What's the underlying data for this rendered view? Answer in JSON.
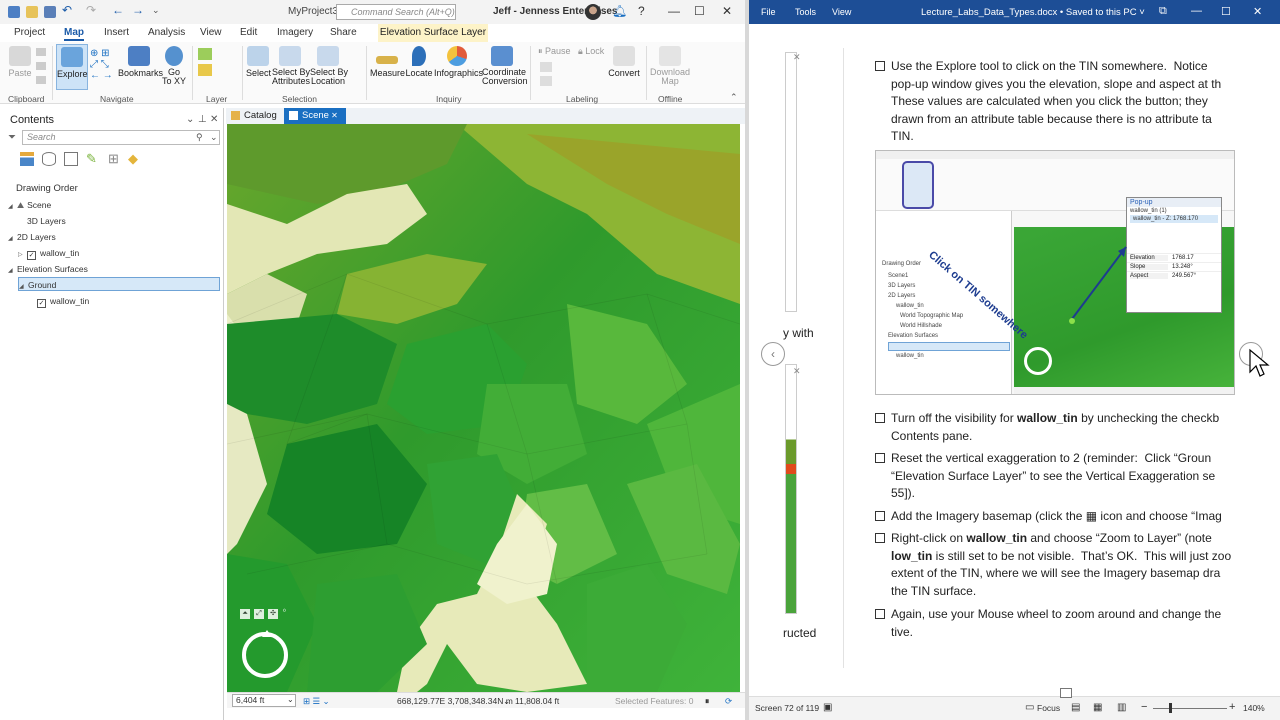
{
  "arcgis": {
    "title": "MyProject3",
    "command_search_placeholder": "Command Search (Alt+Q)",
    "user": "Jeff - Jenness Enterprises",
    "ribbon_tabs": [
      "Project",
      "Map",
      "Insert",
      "Analysis",
      "View",
      "Edit",
      "Imagery",
      "Share"
    ],
    "active_tab": "Map",
    "contextual_tab": "Elevation Surface Layer",
    "ribbon": {
      "paste": "Paste",
      "explore": "Explore",
      "bookmarks": "Bookmarks",
      "goto_xy": "Go\nTo XY",
      "select": "Select",
      "select_by_attributes": "Select By\nAttributes",
      "select_by_location": "Select By\nLocation",
      "measure": "Measure",
      "locate": "Locate",
      "infographics": "Infographics",
      "coordinate_conversion": "Coordinate\nConversion",
      "pause": "Pause",
      "lock": "Lock",
      "convert": "Convert",
      "download_map": "Download\nMap",
      "groups": [
        "Clipboard",
        "Navigate",
        "Layer",
        "Selection",
        "Inquiry",
        "Labeling",
        "Offline"
      ]
    },
    "contents": {
      "title": "Contents",
      "search_placeholder": "Search",
      "drawing_order": "Drawing Order",
      "tree": [
        {
          "label": "Scene",
          "indent": 0,
          "expander": "◢",
          "checkbox": false
        },
        {
          "label": "3D Layers",
          "indent": 1,
          "expander": "",
          "checkbox": false
        },
        {
          "label": "2D Layers",
          "indent": 0,
          "expander": "◢",
          "checkbox": false
        },
        {
          "label": "wallow_tin",
          "indent": 1,
          "expander": "▷",
          "checkbox": true
        },
        {
          "label": "Elevation Surfaces",
          "indent": 0,
          "expander": "◢",
          "checkbox": false
        },
        {
          "label": "Ground",
          "indent": 1,
          "expander": "◢",
          "checkbox": false,
          "selected": true
        },
        {
          "label": "wallow_tin",
          "indent": 2,
          "expander": "",
          "checkbox": true
        }
      ]
    },
    "view_tabs": [
      {
        "label": "Catalog",
        "active": false
      },
      {
        "label": "Scene",
        "active": true
      }
    ],
    "status": {
      "scale": "6,404 ft",
      "coordinates": "668,129.77E 3,708,348.34N m",
      "elevation": "11,808.04 ft",
      "selected_features": "Selected Features: 0"
    }
  },
  "word": {
    "menu": [
      "File",
      "Tools",
      "View"
    ],
    "doc_title": "Lecture_Labs_Data_Types.docx • Saved to this PC ˅",
    "side_text_1": "y with",
    "side_text_2": "ructed",
    "items": [
      {
        "html": "Use the Explore tool to click on the TIN somewhere.  Notice\npop-up window gives you the elevation, slope and aspect at th\nThese values are calculated when you click the button; they\ndrawn from an attribute table because there is no attribute ta\nTIN."
      },
      {
        "html": "Turn off the visibility for <b>wallow_tin</b> by unchecking the checkb\nContents pane."
      },
      {
        "html": "Reset the vertical exaggeration to 2 (reminder:  Click “Groun\n“Elevation Surface Layer” to see the Vertical Exaggeration se\n55])."
      },
      {
        "html": "Add the Imagery basemap (click the ▦ icon and choose “Imag"
      },
      {
        "html": "Right-click on <b>wallow_tin</b> and choose “Zoom to Layer” (note \n<b>low_tin</b> is still set to be not visible.  That’s OK.  This will just zoo\nextent of the TIN, where we will see the Imagery basemap dra\nthe TIN surface."
      },
      {
        "html": "Again, use your Mouse wheel to zoom around and change the\ntive."
      }
    ],
    "embedded": {
      "callout": "Click on TIN somewhere",
      "popup_title": "Pop-up",
      "popup_row": "wallow_tin - Z: 1768.170",
      "popup_item": "wallow_tin (1)",
      "fields": [
        {
          "k": "Elevation",
          "v": "1768.17"
        },
        {
          "k": "Slope",
          "v": "13.248°"
        },
        {
          "k": "Aspect",
          "v": "249.567°"
        }
      ],
      "mini_tree": [
        "Drawing Order",
        "Scene1",
        "3D Layers",
        "2D Layers",
        "wallow_tin",
        "World Topographic Map",
        "World Hillshade",
        "Elevation Surfaces",
        "Ground",
        "wallow_tin"
      ]
    },
    "status": {
      "page": "Screen 72 of 119",
      "focus": "Focus",
      "zoom": "140%"
    }
  },
  "colors": {
    "accent": "#1a6fc2",
    "word_title": "#1d4e96",
    "tin_green": "#3aa334",
    "tin_light": "#e9ecc0",
    "callout": "#1d3c8f"
  }
}
